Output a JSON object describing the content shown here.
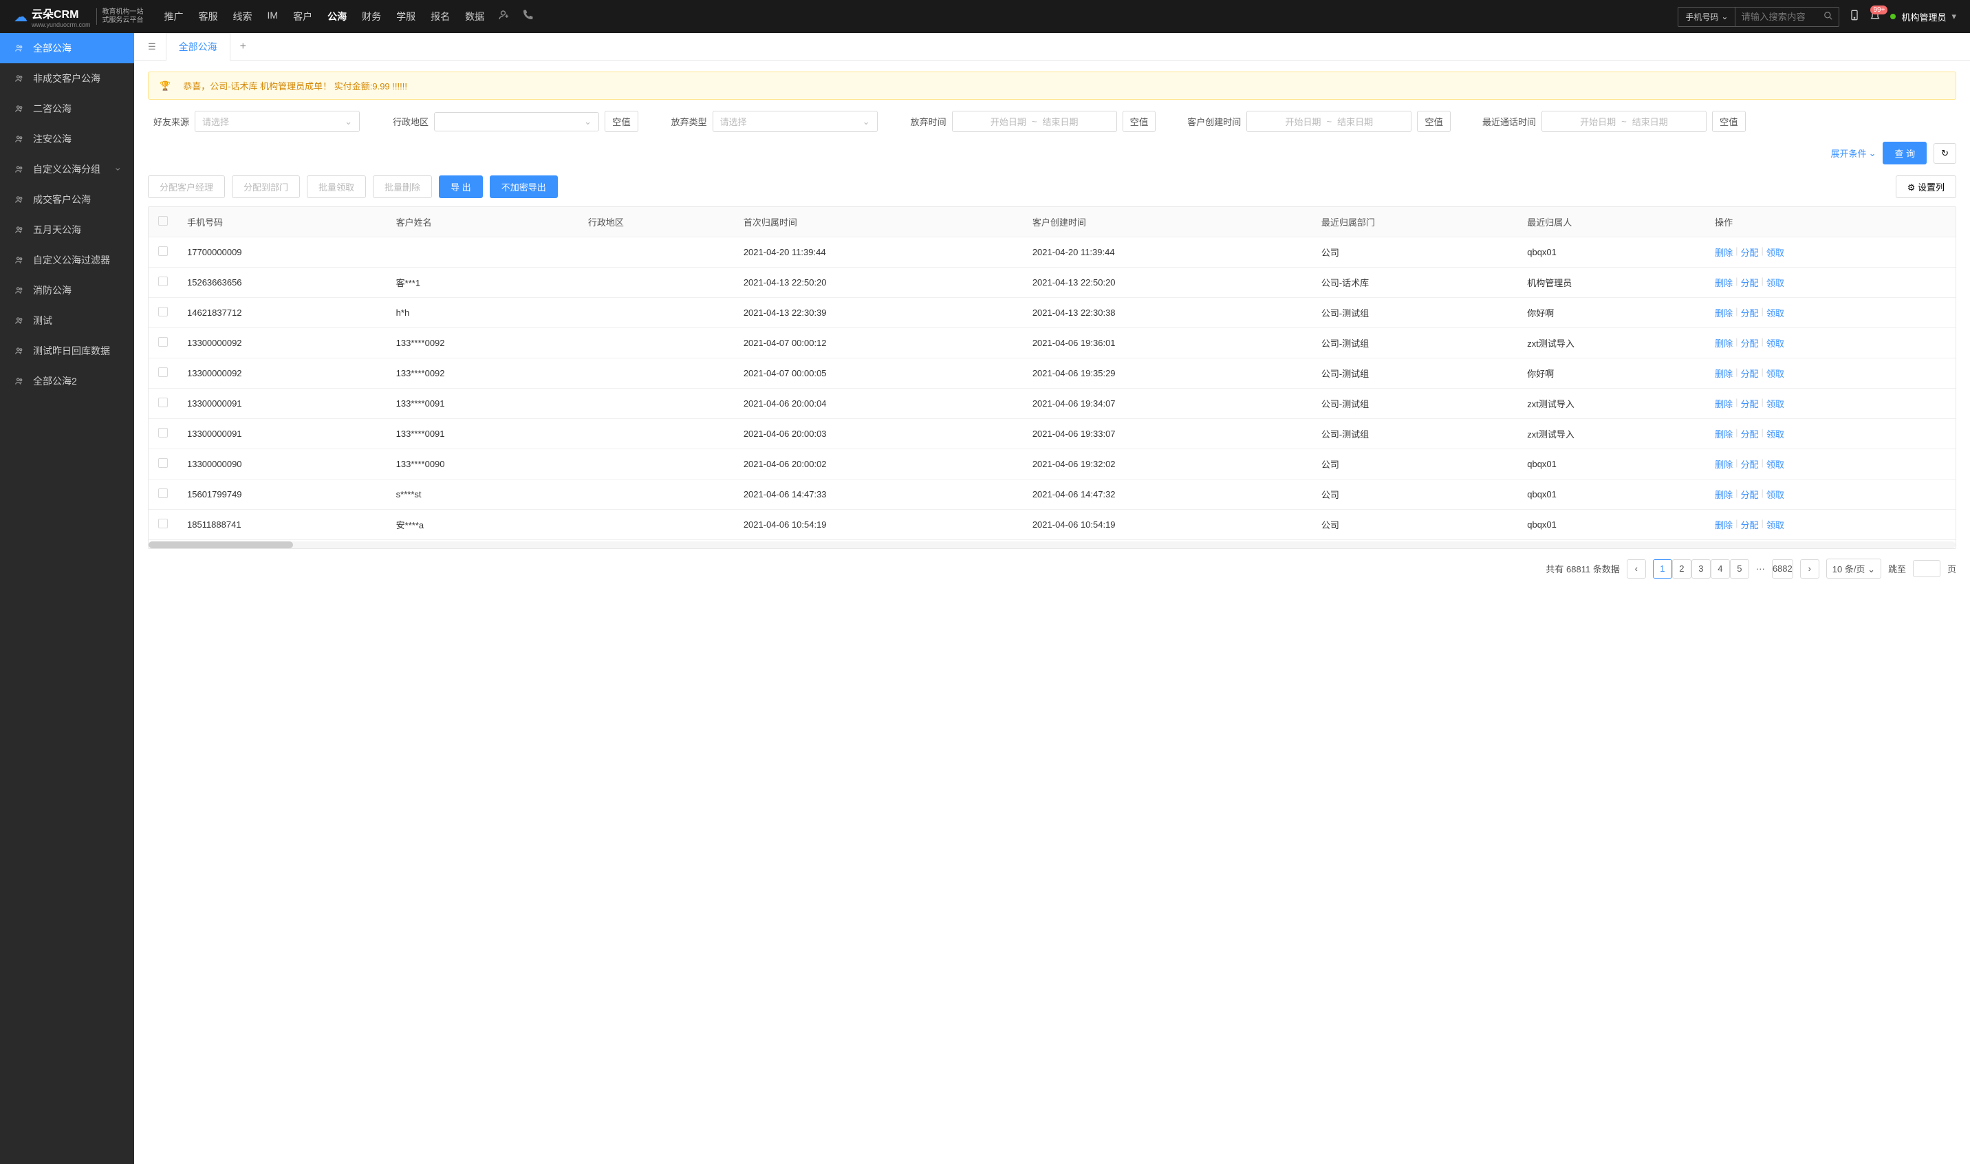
{
  "header": {
    "logo_main": "云朵CRM",
    "logo_url": "www.yunduocrm.com",
    "logo_sub1": "教育机构一站",
    "logo_sub2": "式服务云平台",
    "nav": [
      "推广",
      "客服",
      "线索",
      "IM",
      "客户",
      "公海",
      "财务",
      "学服",
      "报名",
      "数据"
    ],
    "nav_active_index": 5,
    "search_type": "手机号码",
    "search_placeholder": "请输入搜索内容",
    "badge_count": "99+",
    "user_name": "机构管理员"
  },
  "sidebar": {
    "items": [
      {
        "label": "全部公海",
        "icon": "users",
        "active": true
      },
      {
        "label": "非成交客户公海",
        "icon": "users"
      },
      {
        "label": "二咨公海",
        "icon": "users"
      },
      {
        "label": "注安公海",
        "icon": "users"
      },
      {
        "label": "自定义公海分组",
        "icon": "grid",
        "children": true
      },
      {
        "label": "成交客户公海",
        "icon": "users"
      },
      {
        "label": "五月天公海",
        "icon": "users"
      },
      {
        "label": "自定义公海过滤器",
        "icon": "users"
      },
      {
        "label": "消防公海",
        "icon": "users"
      },
      {
        "label": "测试",
        "icon": "users"
      },
      {
        "label": "测试昨日回库数据",
        "icon": "users"
      },
      {
        "label": "全部公海2",
        "icon": "users"
      }
    ]
  },
  "tabs": {
    "items": [
      "全部公海"
    ],
    "active_index": 0
  },
  "banner": {
    "text": "恭喜，公司-话术库  机构管理员成单！  实付金额:9.99 !!!!!!"
  },
  "filters": {
    "source_label": "好友来源",
    "region_label": "行政地区",
    "abandon_type_label": "放弃类型",
    "abandon_time_label": "放弃时间",
    "create_time_label": "客户创建时间",
    "last_call_label": "最近通话时间",
    "select_placeholder": "请选择",
    "start_date": "开始日期",
    "end_date": "结束日期",
    "empty_btn": "空值",
    "expand": "展开条件",
    "query": "查 询"
  },
  "toolbar": {
    "assign_manager": "分配客户经理",
    "assign_dept": "分配到部门",
    "batch_claim": "批量领取",
    "batch_delete": "批量删除",
    "export": "导 出",
    "export_raw": "不加密导出",
    "set_columns": "设置列"
  },
  "table": {
    "columns": [
      "手机号码",
      "客户姓名",
      "行政地区",
      "首次归属时间",
      "客户创建时间",
      "最近归属部门",
      "最近归属人",
      "操作"
    ],
    "actions": {
      "delete": "删除",
      "assign": "分配",
      "claim": "领取"
    },
    "rows": [
      {
        "phone": "17700000009",
        "name": "",
        "region": "",
        "first_time": "2021-04-20 11:39:44",
        "create_time": "2021-04-20 11:39:44",
        "dept": "公司",
        "owner": "qbqx01"
      },
      {
        "phone": "15263663656",
        "name": "客***1",
        "region": "",
        "first_time": "2021-04-13 22:50:20",
        "create_time": "2021-04-13 22:50:20",
        "dept": "公司-话术库",
        "owner": "机构管理员"
      },
      {
        "phone": "14621837712",
        "name": "h*h",
        "region": "",
        "first_time": "2021-04-13 22:30:39",
        "create_time": "2021-04-13 22:30:38",
        "dept": "公司-测试组",
        "owner": "你好啊"
      },
      {
        "phone": "13300000092",
        "name": "133****0092",
        "region": "",
        "first_time": "2021-04-07 00:00:12",
        "create_time": "2021-04-06 19:36:01",
        "dept": "公司-测试组",
        "owner": "zxt测试导入"
      },
      {
        "phone": "13300000092",
        "name": "133****0092",
        "region": "",
        "first_time": "2021-04-07 00:00:05",
        "create_time": "2021-04-06 19:35:29",
        "dept": "公司-测试组",
        "owner": "你好啊"
      },
      {
        "phone": "13300000091",
        "name": "133****0091",
        "region": "",
        "first_time": "2021-04-06 20:00:04",
        "create_time": "2021-04-06 19:34:07",
        "dept": "公司-测试组",
        "owner": "zxt测试导入"
      },
      {
        "phone": "13300000091",
        "name": "133****0091",
        "region": "",
        "first_time": "2021-04-06 20:00:03",
        "create_time": "2021-04-06 19:33:07",
        "dept": "公司-测试组",
        "owner": "zxt测试导入"
      },
      {
        "phone": "13300000090",
        "name": "133****0090",
        "region": "",
        "first_time": "2021-04-06 20:00:02",
        "create_time": "2021-04-06 19:32:02",
        "dept": "公司",
        "owner": "qbqx01"
      },
      {
        "phone": "15601799749",
        "name": "s****st",
        "region": "",
        "first_time": "2021-04-06 14:47:33",
        "create_time": "2021-04-06 14:47:32",
        "dept": "公司",
        "owner": "qbqx01"
      },
      {
        "phone": "18511888741",
        "name": "安****a",
        "region": "",
        "first_time": "2021-04-06 10:54:19",
        "create_time": "2021-04-06 10:54:19",
        "dept": "公司",
        "owner": "qbqx01"
      }
    ]
  },
  "pagination": {
    "total_prefix": "共有",
    "total": "68811",
    "total_suffix": "条数据",
    "pages": [
      "1",
      "2",
      "3",
      "4",
      "5"
    ],
    "ellipsis": "···",
    "last_page": "6882",
    "per_page": "10 条/页",
    "jump_label": "跳至",
    "jump_suffix": "页"
  }
}
